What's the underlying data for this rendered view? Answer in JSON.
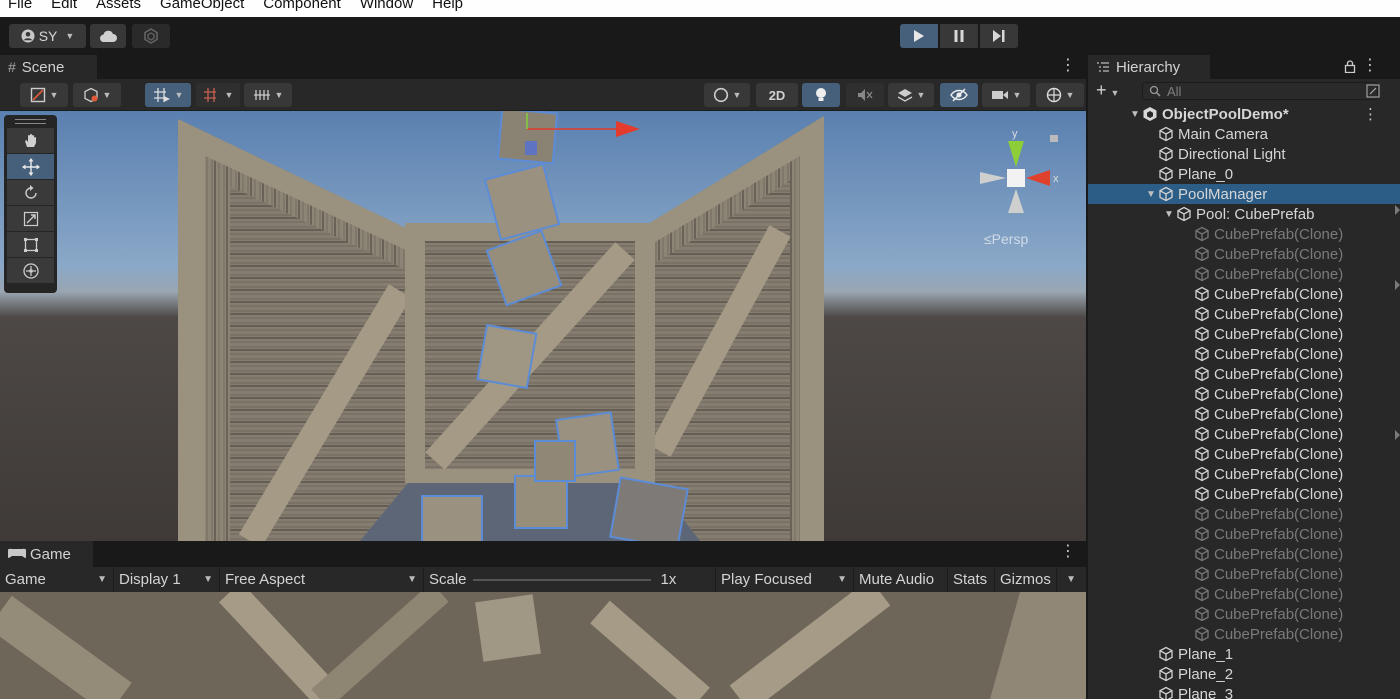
{
  "menu": [
    "File",
    "Edit",
    "Assets",
    "GameObject",
    "Component",
    "Window",
    "Help"
  ],
  "toolbar": {
    "account_label": "SY",
    "icons": [
      "account-icon",
      "cloud-icon",
      "collab-icon",
      "play-icon",
      "pause-icon",
      "step-icon"
    ]
  },
  "scene": {
    "tab_label": "Scene",
    "twod_label": "2D",
    "persp_label": "≤Persp",
    "gizmo_x_label": "x",
    "gizmo_y_label": "y"
  },
  "game": {
    "tab_label": "Game",
    "view_select": "Game",
    "display_select": "Display 1",
    "aspect_select": "Free Aspect",
    "scale_label": "Scale",
    "scale_value": "1x",
    "play_focused": "Play Focused",
    "mute_audio": "Mute Audio",
    "stats": "Stats",
    "gizmos": "Gizmos"
  },
  "hierarchy": {
    "tab_label": "Hierarchy",
    "search_placeholder": "All",
    "scene_name": "ObjectPoolDemo*",
    "items": [
      {
        "label": "Main Camera",
        "depth": 1,
        "dim": false,
        "selected": false,
        "expand": ""
      },
      {
        "label": "Directional Light",
        "depth": 1,
        "dim": false,
        "selected": false,
        "expand": ""
      },
      {
        "label": "Plane_0",
        "depth": 1,
        "dim": false,
        "selected": false,
        "expand": ""
      },
      {
        "label": "PoolManager",
        "depth": 1,
        "dim": false,
        "selected": true,
        "expand": "▼"
      },
      {
        "label": "Pool: CubePrefab",
        "depth": 2,
        "dim": false,
        "selected": false,
        "expand": "▼"
      },
      {
        "label": "CubePrefab(Clone)",
        "depth": 3,
        "dim": true,
        "selected": false,
        "expand": ""
      },
      {
        "label": "CubePrefab(Clone)",
        "depth": 3,
        "dim": true,
        "selected": false,
        "expand": ""
      },
      {
        "label": "CubePrefab(Clone)",
        "depth": 3,
        "dim": true,
        "selected": false,
        "expand": ""
      },
      {
        "label": "CubePrefab(Clone)",
        "depth": 3,
        "dim": false,
        "selected": false,
        "expand": ""
      },
      {
        "label": "CubePrefab(Clone)",
        "depth": 3,
        "dim": false,
        "selected": false,
        "expand": ""
      },
      {
        "label": "CubePrefab(Clone)",
        "depth": 3,
        "dim": false,
        "selected": false,
        "expand": ""
      },
      {
        "label": "CubePrefab(Clone)",
        "depth": 3,
        "dim": false,
        "selected": false,
        "expand": ""
      },
      {
        "label": "CubePrefab(Clone)",
        "depth": 3,
        "dim": false,
        "selected": false,
        "expand": ""
      },
      {
        "label": "CubePrefab(Clone)",
        "depth": 3,
        "dim": false,
        "selected": false,
        "expand": ""
      },
      {
        "label": "CubePrefab(Clone)",
        "depth": 3,
        "dim": false,
        "selected": false,
        "expand": ""
      },
      {
        "label": "CubePrefab(Clone)",
        "depth": 3,
        "dim": false,
        "selected": false,
        "expand": ""
      },
      {
        "label": "CubePrefab(Clone)",
        "depth": 3,
        "dim": false,
        "selected": false,
        "expand": ""
      },
      {
        "label": "CubePrefab(Clone)",
        "depth": 3,
        "dim": false,
        "selected": false,
        "expand": ""
      },
      {
        "label": "CubePrefab(Clone)",
        "depth": 3,
        "dim": false,
        "selected": false,
        "expand": ""
      },
      {
        "label": "CubePrefab(Clone)",
        "depth": 3,
        "dim": true,
        "selected": false,
        "expand": ""
      },
      {
        "label": "CubePrefab(Clone)",
        "depth": 3,
        "dim": true,
        "selected": false,
        "expand": ""
      },
      {
        "label": "CubePrefab(Clone)",
        "depth": 3,
        "dim": true,
        "selected": false,
        "expand": ""
      },
      {
        "label": "CubePrefab(Clone)",
        "depth": 3,
        "dim": true,
        "selected": false,
        "expand": ""
      },
      {
        "label": "CubePrefab(Clone)",
        "depth": 3,
        "dim": true,
        "selected": false,
        "expand": ""
      },
      {
        "label": "CubePrefab(Clone)",
        "depth": 3,
        "dim": true,
        "selected": false,
        "expand": ""
      },
      {
        "label": "CubePrefab(Clone)",
        "depth": 3,
        "dim": true,
        "selected": false,
        "expand": ""
      },
      {
        "label": "Plane_1",
        "depth": 1,
        "dim": false,
        "selected": false,
        "expand": ""
      },
      {
        "label": "Plane_2",
        "depth": 1,
        "dim": false,
        "selected": false,
        "expand": ""
      },
      {
        "label": "Plane_3",
        "depth": 1,
        "dim": false,
        "selected": false,
        "expand": ""
      }
    ]
  },
  "colors": {
    "accent": "#46607c",
    "selection": "#2c5d87",
    "panel": "#282828",
    "background": "#191919"
  }
}
